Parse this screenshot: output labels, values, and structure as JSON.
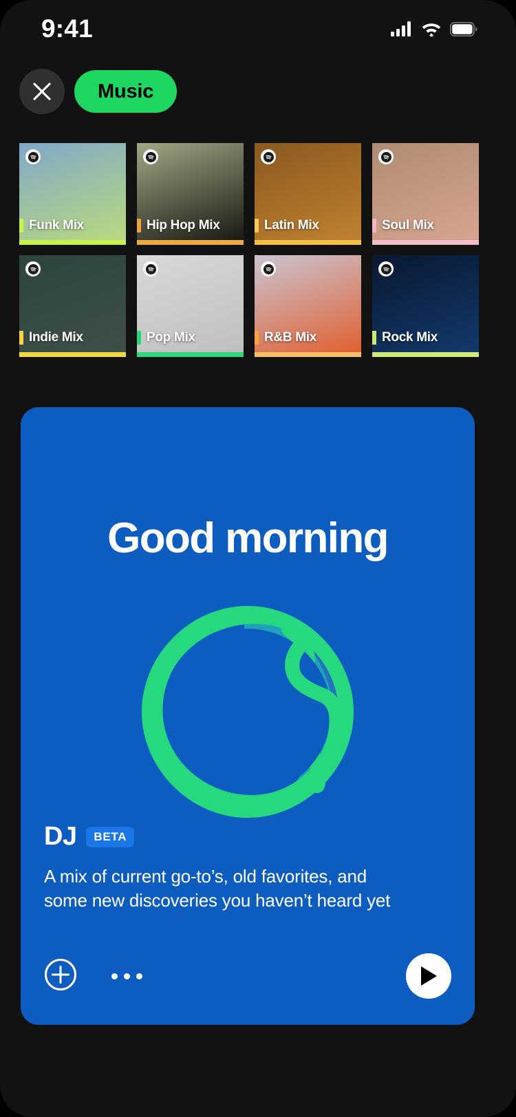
{
  "status_bar": {
    "time": "9:41",
    "icons": [
      "cellular-signal-icon",
      "wifi-icon",
      "battery-icon"
    ]
  },
  "header": {
    "close_icon": "close-icon",
    "filter_label": "Music",
    "filter_active_color": "#1ED760"
  },
  "mix_grid": {
    "badge_icon": "spotify-logo-icon",
    "cards": [
      {
        "title": "Funk Mix",
        "accent": "#C9F24D",
        "stripe": "#C9F24D",
        "art_top": "#7FA8C9",
        "art_bottom": "#B9D97E"
      },
      {
        "title": "Hip Hop Mix",
        "accent": "#F0A23C",
        "stripe": "#F2A93F",
        "art_top": "#9FA885",
        "art_bottom": "#1A1A14"
      },
      {
        "title": "Latin Mix",
        "accent": "#F5C65A",
        "stripe": "#F2C244",
        "art_top": "#8A5A20",
        "art_bottom": "#C08030"
      },
      {
        "title": "Soul Mix",
        "accent": "#F0B6C4",
        "stripe": "#F2BCC8",
        "art_top": "#B08B72",
        "art_bottom": "#D6A48F"
      },
      {
        "title": "Indie Mix",
        "accent": "#F5D73C",
        "stripe": "#F2D93F",
        "art_top": "#2D4440",
        "art_bottom": "#3E5148"
      },
      {
        "title": "Pop Mix",
        "accent": "#23D97A",
        "stripe": "#2DD97D",
        "art_top": "#D8D8D8",
        "art_bottom": "#BFBFBF"
      },
      {
        "title": "R&B Mix",
        "accent": "#F7A53B",
        "stripe": "#F7BE63",
        "art_top": "#C9C4D2",
        "art_bottom": "#E06030"
      },
      {
        "title": "Rock Mix",
        "accent": "#CDEA6A",
        "stripe": "#CFEA77",
        "art_top": "#0A1832",
        "art_bottom": "#123A6B"
      }
    ]
  },
  "dj_card": {
    "background_color": "#0D5CC0",
    "greeting": "Good morning",
    "orb": {
      "icon": "dj-orb-icon",
      "ring_color": "#26D97F",
      "accent_teal": "#1FA8B5",
      "accent_blue": "#1F7BC4"
    },
    "name": "DJ",
    "badge": "BETA",
    "badge_color": "#1B76E8",
    "description": "A mix of current go-to’s, old favorites, and some new discoveries you haven’t heard yet",
    "actions": {
      "add_icon": "plus-circle-icon",
      "more_icon": "more-options-icon",
      "play_icon": "play-icon"
    }
  }
}
